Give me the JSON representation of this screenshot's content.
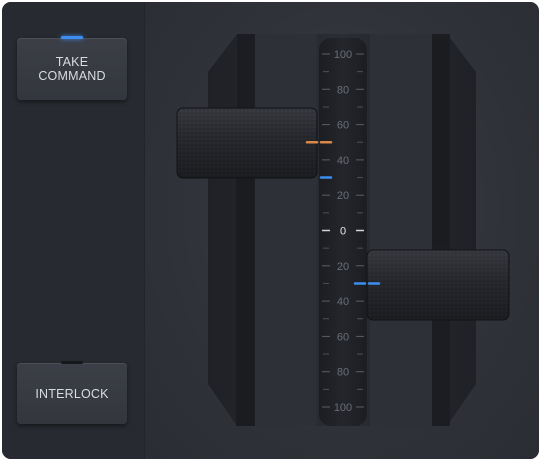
{
  "buttons": {
    "take_command": {
      "line1": "TAKE",
      "line2": "COMMAND",
      "indicator_color": "#3d8ef0",
      "active": true
    },
    "interlock": {
      "label": "INTERLOCK",
      "active": false
    }
  },
  "scale": {
    "ticks": [
      {
        "value": 100,
        "label": "100"
      },
      {
        "value": 80,
        "label": "80"
      },
      {
        "value": 60,
        "label": "60"
      },
      {
        "value": 40,
        "label": "40"
      },
      {
        "value": 20,
        "label": "20"
      },
      {
        "value": 0,
        "label": "0"
      },
      {
        "value": -20,
        "label": "20"
      },
      {
        "value": -40,
        "label": "40"
      },
      {
        "value": -60,
        "label": "60"
      },
      {
        "value": -80,
        "label": "80"
      },
      {
        "value": -100,
        "label": "100"
      }
    ]
  },
  "levers": {
    "left": {
      "position": 50,
      "command_marker": 50,
      "actual_marker": 30,
      "command_color": "#d9884a",
      "actual_color": "#3d8ef0"
    },
    "right": {
      "position": -30,
      "actual_marker": -30,
      "actual_color": "#3d8ef0"
    }
  }
}
